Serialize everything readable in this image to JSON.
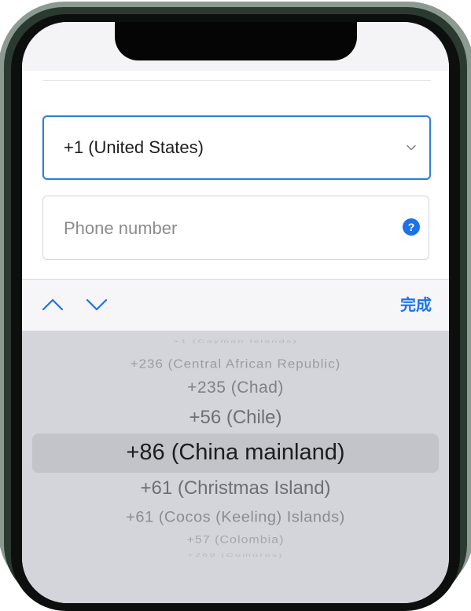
{
  "country_select": {
    "value": "+1 (United States)",
    "icon": "chevron-down-icon"
  },
  "phone_field": {
    "placeholder": "Phone number",
    "help_icon_glyph": "?"
  },
  "toolbar": {
    "done_label": "完成",
    "up_icon": "chevron-up-icon",
    "down_icon": "chevron-down-icon"
  },
  "picker": {
    "items": [
      "+1 (Cayman Islands)",
      "+236 (Central African Republic)",
      "+235 (Chad)",
      "+56 (Chile)",
      "+86 (China mainland)",
      "+61 (Christmas Island)",
      "+61 (Cocos (Keeling) Islands)",
      "+57 (Colombia)",
      "+269 (Comoros)"
    ],
    "selected_index": 4
  },
  "colors": {
    "accent": "#1a73e8",
    "picker_bg": "#d3d5da",
    "frame_green": "#8c9b91"
  }
}
